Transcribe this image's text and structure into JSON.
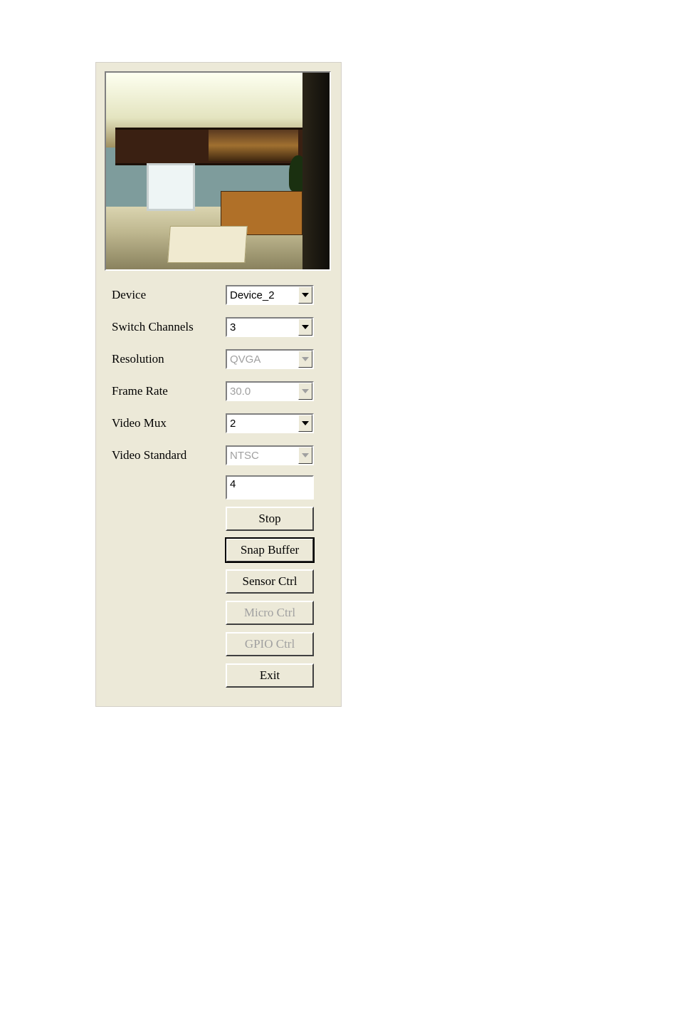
{
  "labels": {
    "device": "Device",
    "switch_channels": "Switch Channels",
    "resolution": "Resolution",
    "frame_rate": "Frame Rate",
    "video_mux": "Video Mux",
    "video_standard": "Video Standard"
  },
  "values": {
    "device": "Device_2",
    "switch_channels": "3",
    "resolution": "QVGA",
    "frame_rate": "30.0",
    "video_mux": "2",
    "video_standard": "NTSC",
    "text_input": "4"
  },
  "buttons": {
    "stop": "Stop",
    "snap_buffer": "Snap Buffer",
    "sensor_ctrl": "Sensor Ctrl",
    "micro_ctrl": "Micro Ctrl",
    "gpio_ctrl": "GPIO Ctrl",
    "exit": "Exit"
  }
}
